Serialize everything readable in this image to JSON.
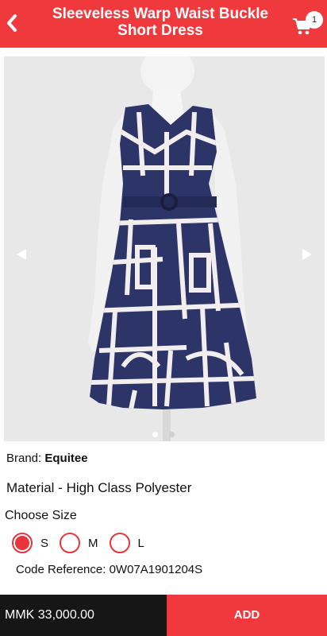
{
  "header": {
    "title_line1": "Sleeveless Warp Waist Buckle",
    "title_line2": "Short Dress",
    "cart_count": "1",
    "back_icon": "chevron-left-icon",
    "cart_icon": "shopping-cart-icon"
  },
  "gallery": {
    "image_description": "mannequin wearing navy and white geometric print sleeveless dress",
    "page_count": 2,
    "active_page": 1
  },
  "product": {
    "brand_label": "Brand:",
    "brand_value": "Equitee",
    "material": "Material - High Class Polyester",
    "choose_size_label": "Choose Size",
    "sizes": [
      {
        "label": "S",
        "selected": true
      },
      {
        "label": "M",
        "selected": false
      },
      {
        "label": "L",
        "selected": false
      }
    ],
    "code_reference": "Code Reference: 0W07A1901204S"
  },
  "footer": {
    "price": "MMK 33,000.00",
    "add_label": "ADD"
  },
  "colors": {
    "accent": "#f0393d",
    "dark_bar": "#161616",
    "dress_navy": "#2c3468"
  }
}
